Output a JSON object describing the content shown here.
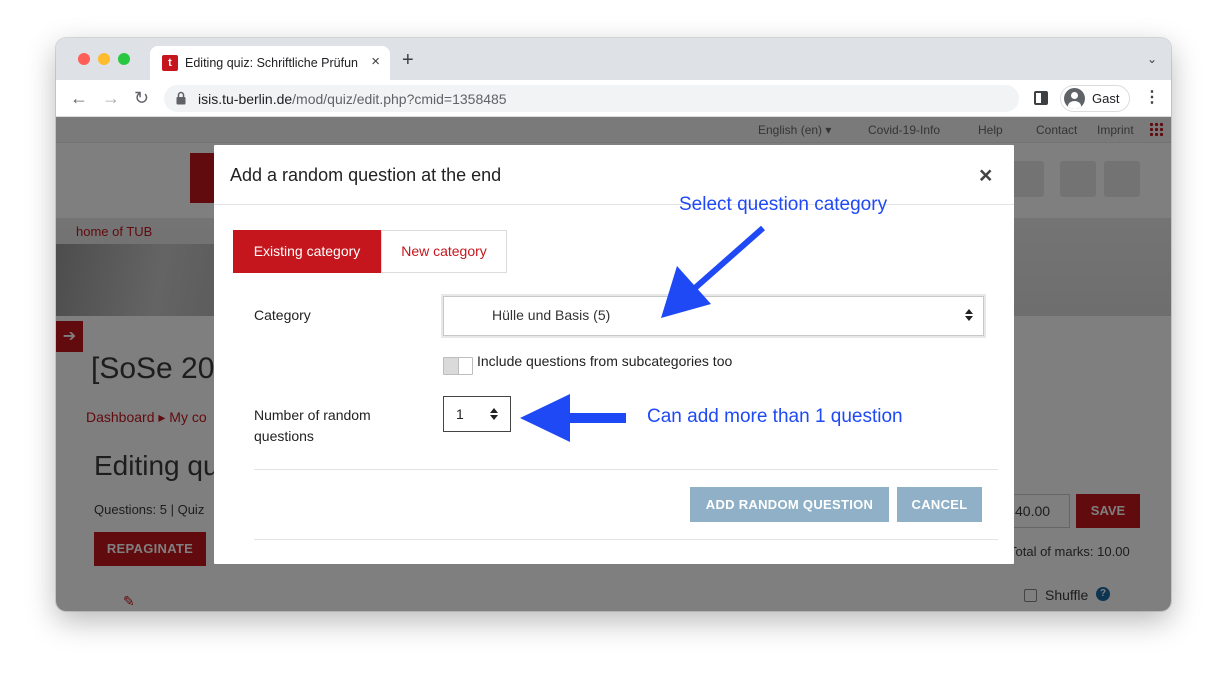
{
  "browser": {
    "tab_title": "Editing quiz: Schriftliche Prüfun",
    "tab_close": "×",
    "new_tab": "+",
    "tab_menu": "⌄",
    "url_host": "isis.tu-berlin.de",
    "url_path": "/mod/quiz/edit.php?cmid=1358485",
    "profile_name": "Gast",
    "back": "←",
    "forward": "→",
    "reload": "↻",
    "menu": "⋮"
  },
  "site": {
    "topbar_links": [
      "English (en) ▾",
      "Covid-19-Info",
      "Help",
      "Contact",
      "Imprint"
    ],
    "home_label": "home of TUB",
    "course_title": "[SoSe 20",
    "breadcrumb": "Dashboard  ▸  My co",
    "page_heading": "Editing qu",
    "quiz_info": "Questions: 5 | Quiz",
    "repaginate_label": "REPAGINATE",
    "max_grade_value": "40.00",
    "save_label": "SAVE",
    "total_marks": "Total of marks: 10.00",
    "shuffle_label": "Shuffle",
    "side_toggle": "➔",
    "help_glyph": "?",
    "pencil_glyph": "✎"
  },
  "modal": {
    "title": "Add a random question at the end",
    "close": "×",
    "tabs": [
      "Existing category",
      "New category"
    ],
    "category_label": "Category",
    "category_value": "Hülle und Basis (5)",
    "subcategories_label": "Include questions from subcategories too",
    "number_label": "Number of random questions",
    "number_value": "1",
    "add_button": "ADD RANDOM QUESTION",
    "cancel_button": "CANCEL"
  },
  "annotations": {
    "select_category": "Select question category",
    "add_more": "Can add more than 1 question",
    "color": "#1f49f5"
  },
  "colors": {
    "brand_red": "#c5161d",
    "disabled_button": "#8fb0c6"
  }
}
